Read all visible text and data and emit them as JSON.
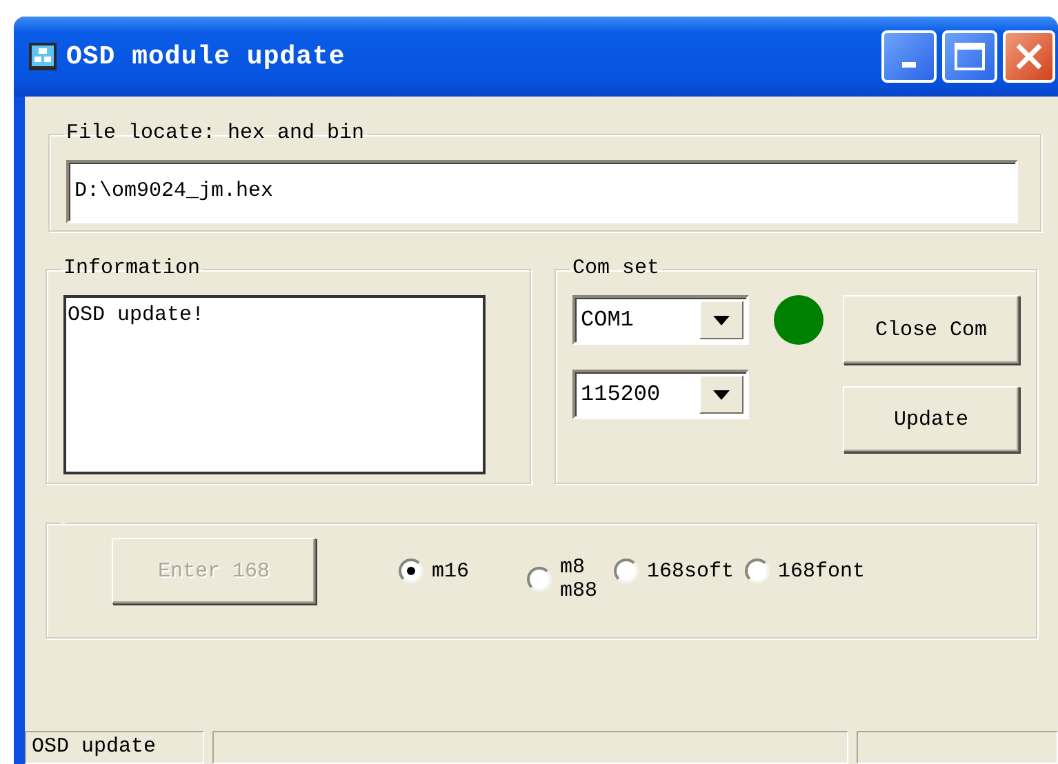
{
  "window": {
    "title": "OSD module update"
  },
  "file_group": {
    "label": "File locate: hex and bin",
    "path": "D:\\om9024_jm.hex"
  },
  "information": {
    "label": "Information",
    "text": "OSD update!"
  },
  "com_set": {
    "label": "Com set",
    "port": "COM1",
    "baud": "115200",
    "port_open": true,
    "buttons": [
      "Close Com",
      "Update"
    ]
  },
  "mode": {
    "button": {
      "label": "Enter 168",
      "disabled": true
    },
    "options": [
      {
        "label": "m16",
        "selected": true
      },
      {
        "label": "m8\nm88",
        "selected": false
      },
      {
        "label": "168soft",
        "selected": false
      },
      {
        "label": "168font",
        "selected": false
      }
    ]
  },
  "status_bar": {
    "text": "OSD update"
  }
}
